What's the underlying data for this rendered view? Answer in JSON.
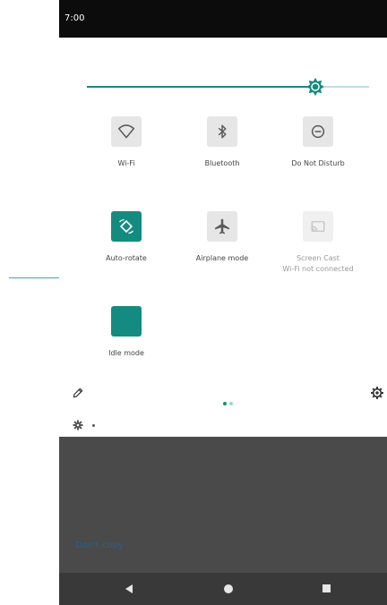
{
  "status_bar": {
    "time": "7:00"
  },
  "brightness": {
    "level": 0.81
  },
  "tiles": [
    {
      "id": "wifi",
      "label": "Wi-Fi",
      "sub": "",
      "state": "off",
      "icon": "wifi-icon"
    },
    {
      "id": "bluetooth",
      "label": "Bluetooth",
      "sub": "",
      "state": "off",
      "icon": "bluetooth-icon"
    },
    {
      "id": "dnd",
      "label": "Do Not Disturb",
      "sub": "",
      "state": "off",
      "icon": "do-not-disturb-icon"
    },
    {
      "id": "autorotate",
      "label": "Auto-rotate",
      "sub": "",
      "state": "on",
      "icon": "auto-rotate-icon"
    },
    {
      "id": "airplane",
      "label": "Airplane mode",
      "sub": "",
      "state": "off",
      "icon": "airplane-icon"
    },
    {
      "id": "cast",
      "label": "Screen Cast",
      "sub": "Wi-Fi not connected",
      "state": "unavailable",
      "icon": "cast-icon"
    },
    {
      "id": "idle",
      "label": "Idle mode",
      "sub": "",
      "state": "on",
      "icon": "moon-icon"
    }
  ],
  "pager": {
    "pages": 2,
    "current": 1
  },
  "background_text": "Don't copy",
  "colors": {
    "accent": "#148b80",
    "track_inactive": "#bfe0dc",
    "status_bar": "#0c0c0c",
    "scrim": "#4a4a4a",
    "nav_bar": "#393939"
  }
}
